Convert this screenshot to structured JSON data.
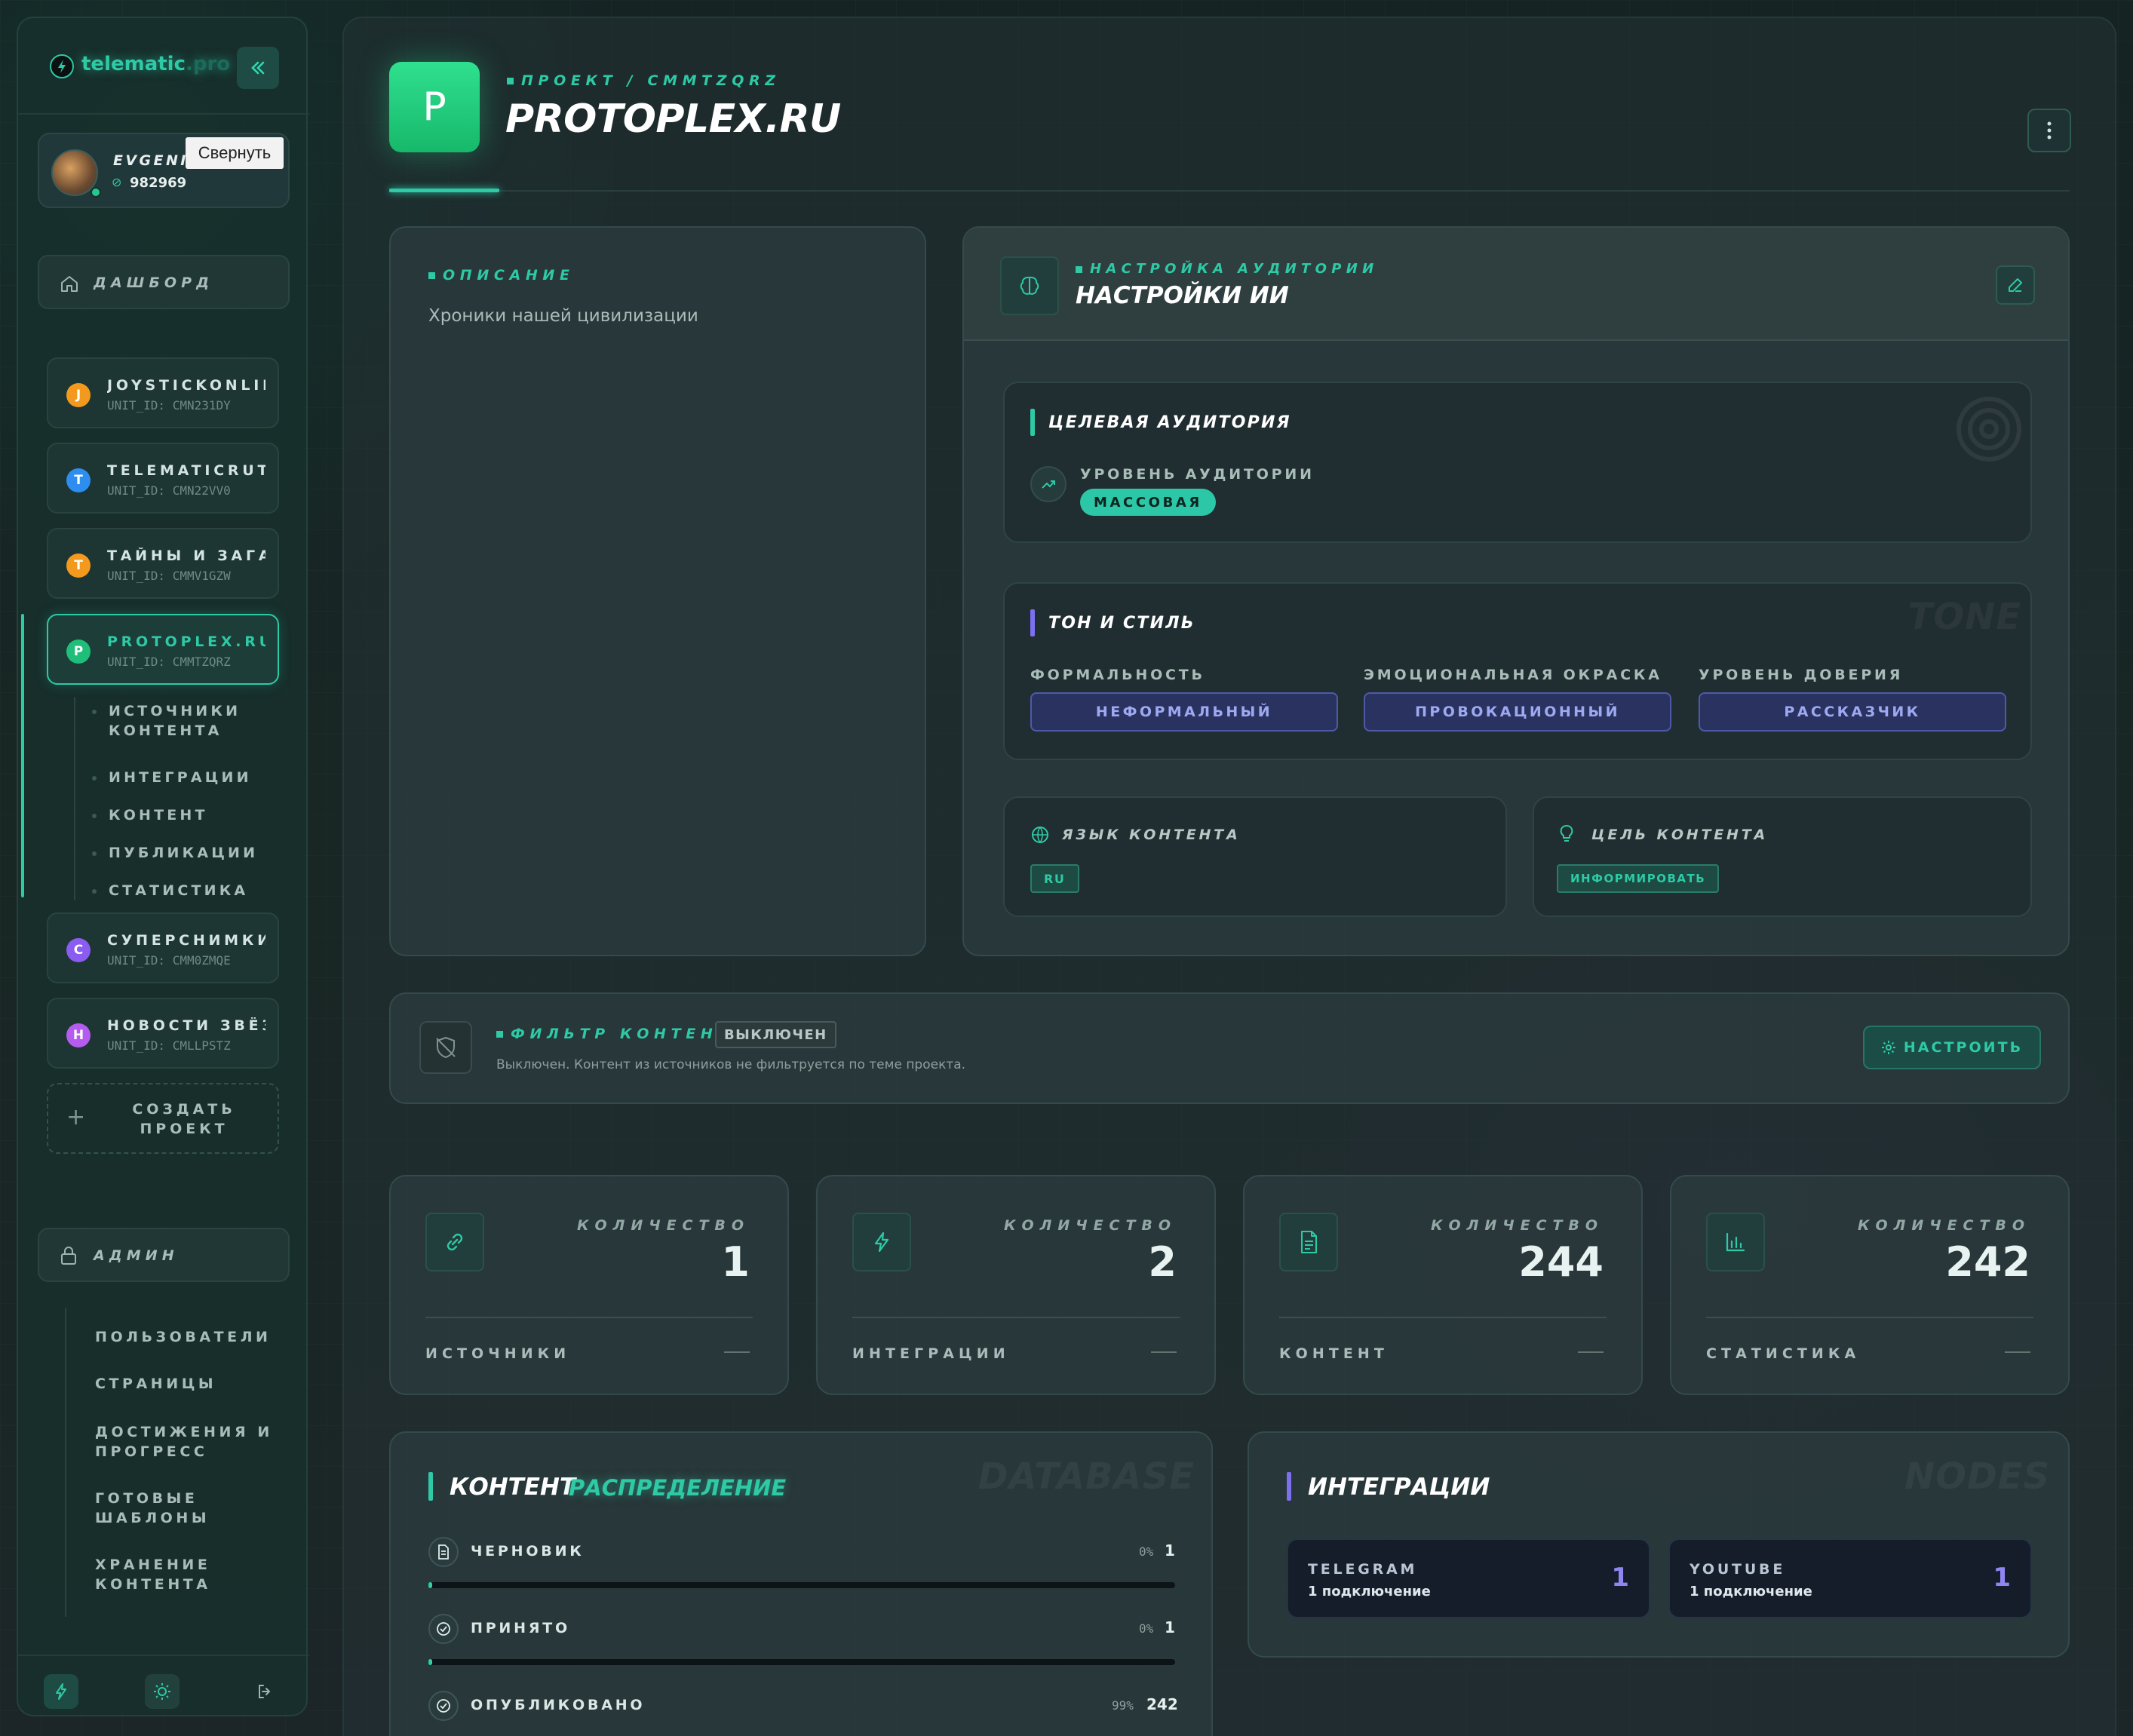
{
  "sidebar": {
    "brand": "telematic",
    "brand_suffix": ".pro",
    "collapse_icon": "double-chevron-left-icon",
    "tooltip": "Свернуть",
    "user": {
      "name": "EVGENII",
      "balance": "982969"
    },
    "dashboard_label": "ДАШБОРД",
    "projects": [
      {
        "letter": "J",
        "name": "JOYSTICKONLIN",
        "uid": "UNIT_ID: CMN231DY",
        "color": "#f39a1e"
      },
      {
        "letter": "T",
        "name": "TELEMATICRUTO",
        "uid": "UNIT_ID: CMN22VV0",
        "color": "#2d8ef0"
      },
      {
        "letter": "T",
        "name": "ТАЙНЫ И ЗАГАДК",
        "uid": "UNIT_ID: CMMV1GZW",
        "color": "#f39a1e"
      },
      {
        "letter": "P",
        "name": "PROTOPLEX.RU",
        "uid": "UNIT_ID: CMMTZQRZ",
        "color": "#1fbf7a"
      },
      {
        "letter": "С",
        "name": "СУПЕРСНИМКИ",
        "uid": "UNIT_ID: CMM0ZMQE",
        "color": "#8a5cf0"
      },
      {
        "letter": "Н",
        "name": "НОВОСТИ ЗВЁЗД",
        "uid": "UNIT_ID: CMLLPSTZ",
        "color": "#b55cf0"
      }
    ],
    "active_sub": [
      {
        "l1": "ИСТОЧНИКИ",
        "l2": "КОНТЕНТА"
      },
      {
        "l1": "ИНТЕГРАЦИИ",
        "l2": ""
      },
      {
        "l1": "КОНТЕНТ",
        "l2": ""
      },
      {
        "l1": "ПУБЛИКАЦИИ",
        "l2": ""
      },
      {
        "l1": "СТАТИСТИКА",
        "l2": ""
      }
    ],
    "create_l1": "СОЗДАТЬ",
    "create_l2": "ПРОЕКТ",
    "admin_label": "АДМИН",
    "admin_items": [
      {
        "l1": "ПОЛЬЗОВАТЕЛИ",
        "l2": ""
      },
      {
        "l1": "СТРАНИЦЫ",
        "l2": ""
      },
      {
        "l1": "ДОСТИЖЕНИЯ И",
        "l2": "ПРОГРЕСС"
      },
      {
        "l1": "ГОТОВЫЕ",
        "l2": "ШАБЛОНЫ"
      },
      {
        "l1": "ХРАНЕНИЕ",
        "l2": "КОНТЕНТА"
      }
    ]
  },
  "header": {
    "avatar_letter": "P",
    "breadcrumb": "ПРОЕКТ / CMMTZQRZ",
    "title": "PROTOPLEX.RU",
    "menu_icon": "more-vertical-icon"
  },
  "description": {
    "tag": "ОПИСАНИЕ",
    "text": "Хроники нашей цивилизации"
  },
  "ai": {
    "tag": "НАСТРОЙКА АУДИТОРИИ",
    "title": "НАСТРОЙКИ ИИ",
    "audience_title": "ЦЕЛЕВАЯ АУДИТОРИЯ",
    "audience_level_label": "УРОВЕНЬ АУДИТОРИИ",
    "audience_level_value": "МАССОВАЯ",
    "tone_title": "ТОН И СТИЛЬ",
    "tone_watermark": "TONE",
    "formality_label": "ФОРМАЛЬНОСТЬ",
    "formality_value": "НЕФОРМАЛЬНЫЙ",
    "emotion_label": "ЭМОЦИОНАЛЬНАЯ ОКРАСКА",
    "emotion_value": "ПРОВОКАЦИОННЫЙ",
    "trust_label": "УРОВЕНЬ ДОВЕРИЯ",
    "trust_value": "РАССКАЗЧИК",
    "lang_label": "ЯЗЫК КОНТЕНТА",
    "lang_value": "RU",
    "goal_label": "ЦЕЛЬ КОНТЕНТА",
    "goal_value": "ИНФОРМИРОВАТЬ"
  },
  "filter": {
    "tag": "ФИЛЬТР КОНТЕНТА",
    "status": "ВЫКЛЮЧЕН",
    "text": "Выключен. Контент из источников не фильтруется по теме проекта.",
    "button": "НАСТРОИТЬ"
  },
  "stats": [
    {
      "kicker": "КОЛИЧЕСТВО",
      "value": "1",
      "name": "ИСТОЧНИКИ",
      "icon": "link-icon"
    },
    {
      "kicker": "КОЛИЧЕСТВО",
      "value": "2",
      "name": "ИНТЕГРАЦИИ",
      "icon": "lightning-icon"
    },
    {
      "kicker": "КОЛИЧЕСТВО",
      "value": "244",
      "name": "КОНТЕНТ",
      "icon": "document-icon"
    },
    {
      "kicker": "КОЛИЧЕСТВО",
      "value": "242",
      "name": "СТАТИСТИКА",
      "icon": "bar-chart-icon"
    }
  ],
  "content": {
    "title_a": "КОНТЕНТ",
    "title_b": "РАСПРЕДЕЛЕНИЕ",
    "watermark": "DATABASE",
    "rows": [
      {
        "label": "ЧЕРНОВИК",
        "percent_text": "0%",
        "value": "1",
        "fill": 0.005
      },
      {
        "label": "ПРИНЯТО",
        "percent_text": "0%",
        "value": "1",
        "fill": 0.005
      },
      {
        "label": "ОПУБЛИКОВАНО",
        "percent_text": "99%",
        "value": "242",
        "fill": 0.99
      }
    ]
  },
  "integrations": {
    "title": "ИНТЕГРАЦИИ",
    "watermark": "NODES",
    "items": [
      {
        "name": "TELEGRAM",
        "sub": "1 подключение",
        "value": "1"
      },
      {
        "name": "YOUTUBE",
        "sub": "1 подключение",
        "value": "1"
      }
    ]
  },
  "colors": {
    "accent": "#2ec9a5",
    "purple": "#8f86f3",
    "bg": "#13201f"
  }
}
